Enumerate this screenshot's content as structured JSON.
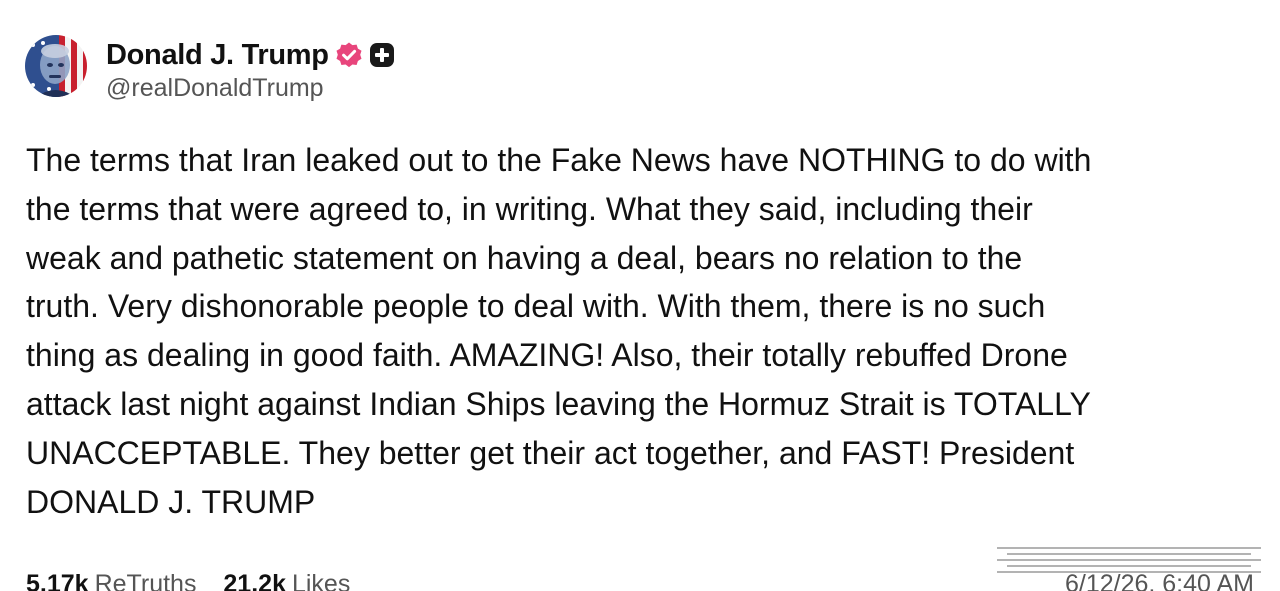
{
  "author": {
    "display_name": "Donald J. Trump",
    "handle": "@realDonaldTrump",
    "avatar_icon": "portrait-flag-avatar",
    "verified_icon": "verified-check-icon",
    "plus_icon": "plus-badge-icon"
  },
  "post": {
    "text": "The terms that Iran leaked out to the Fake News have NOTHING to do with\nthe terms that were agreed to, in writing. What they said, including their\nweak and pathetic statement on having a deal, bears no relation to the\ntruth. Very dishonorable people to deal with. With them, there is no such\nthing as dealing in good faith. AMAZING! Also, their totally rebuffed Drone\nattack last night against Indian Ships leaving the Hormuz Strait is TOTALLY\nUNACCEPTABLE. They better get their act together, and FAST! President\nDONALD J. TRUMP"
  },
  "stats": {
    "retruths_count": "5.17k",
    "retruths_label": "ReTruths",
    "likes_count": "21.2k",
    "likes_label": "Likes"
  },
  "timestamp": "6/12/26, 6:40 AM",
  "colors": {
    "text": "#111111",
    "secondary_text": "#555555",
    "verified_badge": "#e8457c",
    "plus_badge": "#1a1a1a",
    "background": "#ffffff"
  }
}
